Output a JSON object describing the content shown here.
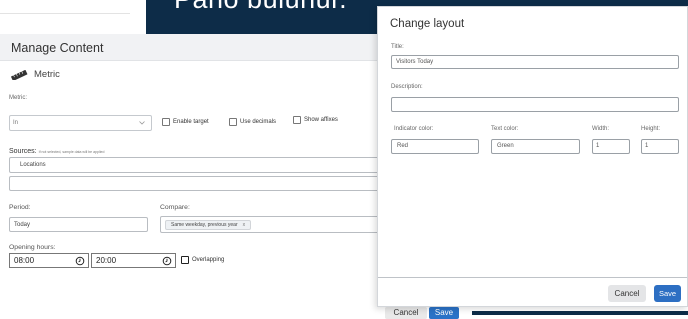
{
  "banner": {
    "text": "Pano bulunur."
  },
  "manage": {
    "title": "Manage Content",
    "metric_heading": "Metric",
    "metric_label": "Metric:",
    "metric_select_value": "In",
    "enable_target_label": "Enable target",
    "use_decimals_label": "Use decimals",
    "show_affixes_label": "Show affixes",
    "sources_label": "Sources:",
    "sources_note": "If not selected, sample data will be applied",
    "sources_value": "Locations",
    "sources_second_value": "",
    "period_label": "Period:",
    "period_value": "Today",
    "compare_label": "Compare:",
    "compare_tag": "Same weekday, previous year",
    "compare_tag_remove": "x",
    "opening_hours_label": "Opening hours:",
    "open_time": "08:00",
    "close_time": "20:00",
    "overlapping_label": "Overlapping",
    "cancel_label": "Cancel",
    "save_label": "Save"
  },
  "modal": {
    "title": "Change layout",
    "title_label": "Title:",
    "title_value": "Visitors Today",
    "description_label": "Description:",
    "description_value": "",
    "indicator_color_label": "Indicator color:",
    "indicator_color_value": "Red",
    "text_color_label": "Text color:",
    "text_color_value": "Green",
    "width_label": "Width:",
    "width_value": "1",
    "height_label": "Height:",
    "height_value": "1",
    "cancel_label": "Cancel",
    "save_label": "Save"
  },
  "colors": {
    "banner_bg": "#0d2c48",
    "primary_button": "#2d6fc3"
  }
}
